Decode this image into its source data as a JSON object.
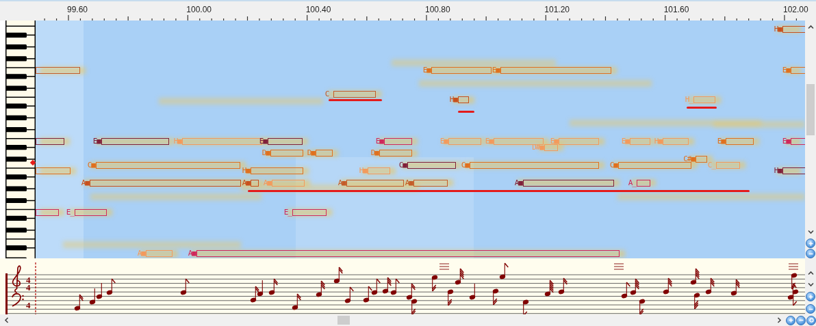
{
  "ruler": {
    "labels": [
      "99.60",
      "100.00",
      "100.40",
      "100.80",
      "101.20",
      "101.60",
      "102.00"
    ]
  },
  "roll": {
    "notes": [
      {
        "label": "H■",
        "color": "#c8501c"
      },
      {
        "color": "#c45c28"
      },
      {
        "label": "E■",
        "color": "#e0701e"
      },
      {
        "label": "E■",
        "color": "#e0701e"
      },
      {
        "label": "E■",
        "color": "#e0701e"
      },
      {
        "label": "C_",
        "color": "#c45c28"
      },
      {
        "label": "H■",
        "color": "#c8501c"
      },
      {
        "label": "H_",
        "color": "#f39a5c"
      },
      {
        "color": "#80203a"
      },
      {
        "label": "E■",
        "color": "#80203a"
      },
      {
        "label": "H■",
        "color": "#f39a5c"
      },
      {
        "label": "E■",
        "color": "#80203a"
      },
      {
        "label": "E■",
        "color": "#d0285a"
      },
      {
        "label": "E■",
        "color": "#f39a5c"
      },
      {
        "label": "E■",
        "color": "#f39a5c"
      },
      {
        "label": "E■",
        "color": "#f39a5c"
      },
      {
        "label": "E■",
        "color": "#f39a5c"
      },
      {
        "label": "H■",
        "color": "#f39a5c"
      },
      {
        "label": "E■",
        "color": "#e0701e"
      },
      {
        "label": "E■",
        "color": "#d0285a"
      },
      {
        "label": "D#■",
        "color": "#f39a5c"
      },
      {
        "label": "D■",
        "color": "#e0701e"
      },
      {
        "label": "D■",
        "color": "#e0701e"
      },
      {
        "label": "D■",
        "color": "#e0701e"
      },
      {
        "label": "C#■",
        "color": "#e0701e"
      },
      {
        "label": "C■",
        "color": "#e0701e"
      },
      {
        "label": "C■",
        "color": "#80203a"
      },
      {
        "label": "C■",
        "color": "#e0701e"
      },
      {
        "label": "C■",
        "color": "#e0701e"
      },
      {
        "label": "C_",
        "color": "#f39a5c"
      },
      {
        "color": "#e0701e"
      },
      {
        "label": "H■",
        "color": "#e0701e"
      },
      {
        "label": "H■",
        "color": "#f39a5c"
      },
      {
        "label": "H■",
        "color": "#80203a"
      },
      {
        "label": "A■",
        "color": "#c8501c"
      },
      {
        "label": "A■",
        "color": "#c8501c"
      },
      {
        "label": "A■",
        "color": "#f39a5c"
      },
      {
        "label": "A■",
        "color": "#c45c28"
      },
      {
        "label": "A■",
        "color": "#c45c28"
      },
      {
        "label": "A■",
        "color": "#80203a"
      },
      {
        "label": "A_",
        "color": "#d0285a"
      },
      {
        "color": "#d0285a"
      },
      {
        "label": "E_",
        "color": "#d0285a"
      },
      {
        "label": "E_",
        "color": "#d0285a"
      },
      {
        "label": "A■",
        "color": "#f39a5c"
      },
      {
        "label": "A■",
        "color": "#d0285a"
      }
    ]
  },
  "score": {
    "treble_time_signature": [
      "4",
      "4"
    ],
    "bass_time_signature": [
      "4"
    ]
  }
}
